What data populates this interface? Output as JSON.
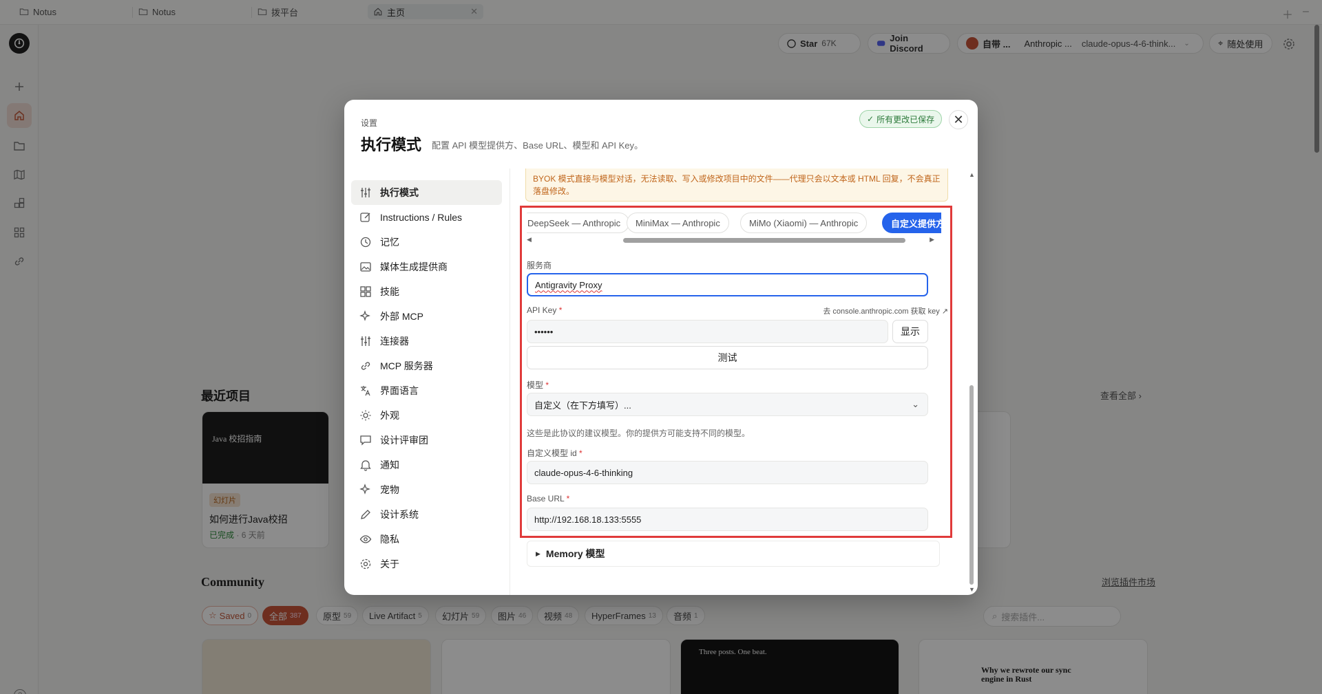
{
  "tabs": [
    {
      "label": "Notus"
    },
    {
      "label": "Notus"
    },
    {
      "label": "拨平台"
    },
    {
      "label": "主页"
    }
  ],
  "header": {
    "star_label": "Star",
    "star_count": "67K",
    "discord_label": "Join Discord",
    "provider_short": "自带 ...",
    "provider_name": "Anthropic ...",
    "model_name": "claude-opus-4-6-think...",
    "use_anywhere": "随处使用"
  },
  "recent": {
    "title": "最近项目",
    "view_all": "查看全部",
    "card": {
      "thumb_title": "Java 校招指南",
      "tag": "幻灯片",
      "name": "如何进行Java校招",
      "status": "已完成",
      "time": "· 6 天前"
    }
  },
  "community": {
    "title": "Community",
    "browse": "浏览插件市场",
    "search_placeholder": "搜索插件...",
    "chips": [
      {
        "label": "Saved",
        "count": "0"
      },
      {
        "label": "全部",
        "count": "387"
      },
      {
        "label": "原型",
        "count": "59"
      },
      {
        "label": "Live Artifact",
        "count": "5"
      },
      {
        "label": "幻灯片",
        "count": "59"
      },
      {
        "label": "图片",
        "count": "46"
      },
      {
        "label": "视频",
        "count": "48"
      },
      {
        "label": "HyperFrames",
        "count": "13"
      },
      {
        "label": "音频",
        "count": "1"
      }
    ],
    "card3_text": "Three posts. One beat.",
    "card4_text": "Why we rewrote our sync engine in Rust"
  },
  "modal": {
    "eyebrow": "设置",
    "title": "执行模式",
    "subtitle": "配置 API 模型提供方、Base URL、模型和 API Key。",
    "saved_badge": "所有更改已保存",
    "nav": [
      {
        "label": "执行模式",
        "icon": "sliders-icon"
      },
      {
        "label": "Instructions / Rules",
        "icon": "edit-icon"
      },
      {
        "label": "记忆",
        "icon": "history-icon"
      },
      {
        "label": "媒体生成提供商",
        "icon": "image-icon"
      },
      {
        "label": "技能",
        "icon": "grid-icon"
      },
      {
        "label": "外部 MCP",
        "icon": "sparkle-icon"
      },
      {
        "label": "连接器",
        "icon": "sliders-icon"
      },
      {
        "label": "MCP 服务器",
        "icon": "link-icon"
      },
      {
        "label": "界面语言",
        "icon": "translate-icon"
      },
      {
        "label": "外观",
        "icon": "sun-icon"
      },
      {
        "label": "设计评审团",
        "icon": "chat-icon"
      },
      {
        "label": "通知",
        "icon": "bell-icon"
      },
      {
        "label": "宠物",
        "icon": "sparkle-icon"
      },
      {
        "label": "设计系统",
        "icon": "pen-icon"
      },
      {
        "label": "隐私",
        "icon": "eye-icon"
      },
      {
        "label": "关于",
        "icon": "gear-icon"
      }
    ],
    "warning": "BYOK 模式直接与模型对话，无法读取、写入或修改项目中的文件——代理只会以文本或 HTML 回复，不会真正落盘修改。",
    "providers": [
      {
        "label": "DeepSeek — Anthropic"
      },
      {
        "label": "MiniMax — Anthropic"
      },
      {
        "label": "MiMo (Xiaomi) — Anthropic"
      },
      {
        "label": "自定义提供方"
      }
    ],
    "form": {
      "vendor_label": "服务商",
      "vendor_value": "Antigravity Proxy",
      "apikey_label": "API Key",
      "apikey_link": "去 console.anthropic.com 获取 key ↗",
      "apikey_value": "••••••",
      "show_button": "显示",
      "test_button": "测试",
      "model_label": "模型",
      "model_value": "自定义（在下方填写）...",
      "model_hint": "这些是此协议的建议模型。你的提供方可能支持不同的模型。",
      "custom_model_label": "自定义模型 id",
      "custom_model_value": "claude-opus-4-6-thinking",
      "base_url_label": "Base URL",
      "base_url_value": "http://192.168.18.133:5555",
      "required_mark": "*"
    },
    "memory_label": "Memory 模型"
  },
  "colors": {
    "accent": "#c8553a",
    "primary_blue": "#2563eb",
    "highlight_red": "#e03a3a",
    "warning_text": "#c0651b"
  }
}
